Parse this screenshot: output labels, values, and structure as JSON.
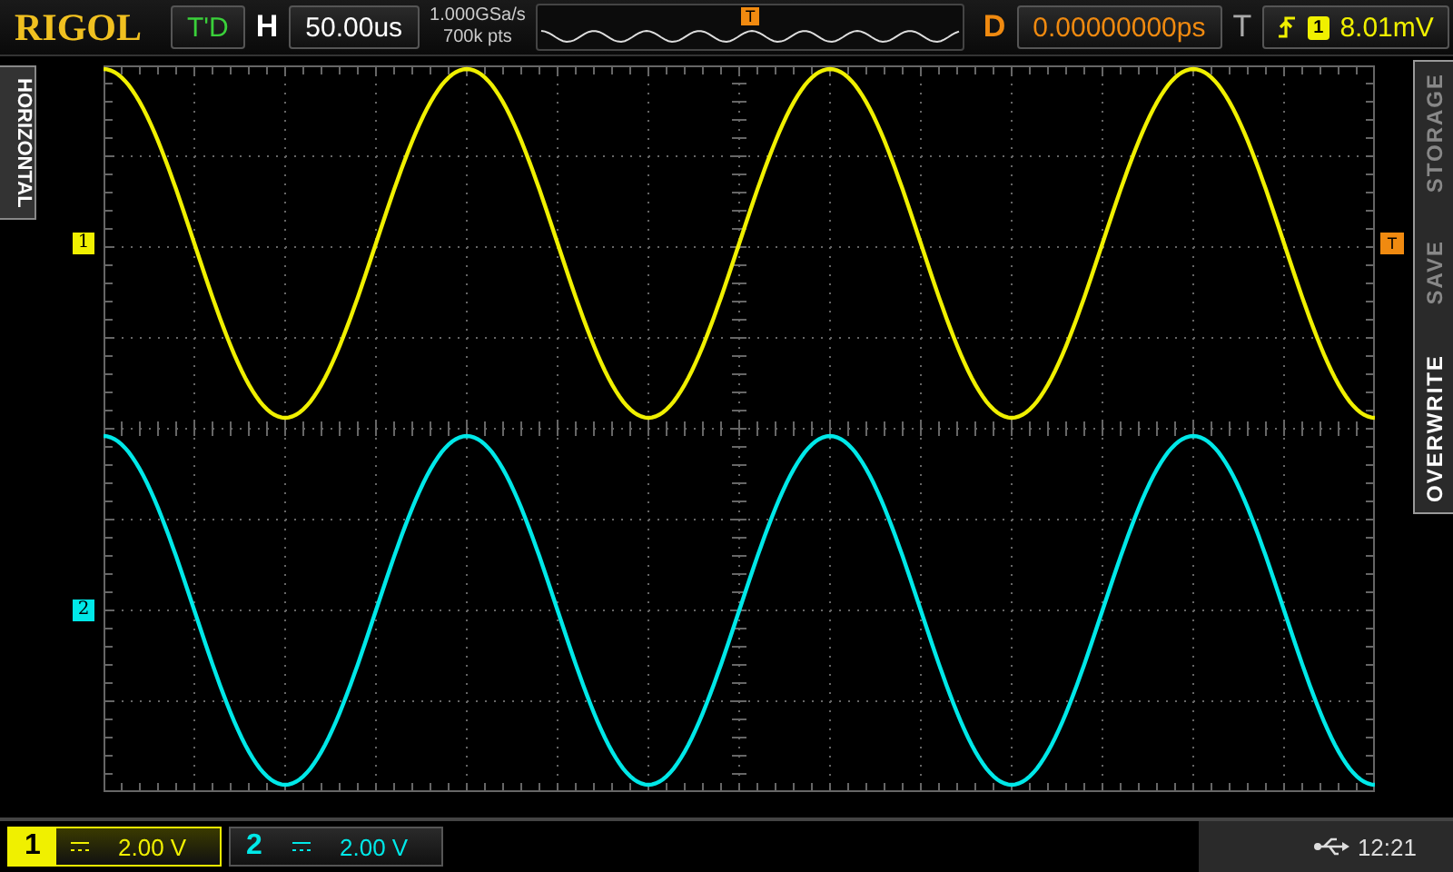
{
  "brand": "RIGOL",
  "run_status": "T'D",
  "horizontal": {
    "label": "H",
    "timebase": "50.00us",
    "sample_rate": "1.000GSa/s",
    "memory_depth": "700k pts"
  },
  "delay": {
    "label": "D",
    "value": "0.00000000ps"
  },
  "trigger": {
    "label": "T",
    "source": "1",
    "level": "8.01mV"
  },
  "channel_markers": [
    {
      "label": "1",
      "color": "#f0f000"
    },
    {
      "label": "2",
      "color": "#00e8e8"
    }
  ],
  "trigger_position_marker": "T",
  "trigger_level_marker": "T",
  "side_tab": "HORIZONTAL",
  "menu": [
    {
      "label": "STORAGE",
      "selected": false
    },
    {
      "label": "SAVE",
      "selected": false
    },
    {
      "label": "OVERWRITE",
      "selected": true
    }
  ],
  "channels": [
    {
      "number": "1",
      "scale": "2.00 V",
      "color": "#f0f000",
      "selected": true
    },
    {
      "number": "2",
      "scale": "2.00 V",
      "color": "#00e8e8",
      "selected": false
    }
  ],
  "status": {
    "time": "12:21"
  }
}
